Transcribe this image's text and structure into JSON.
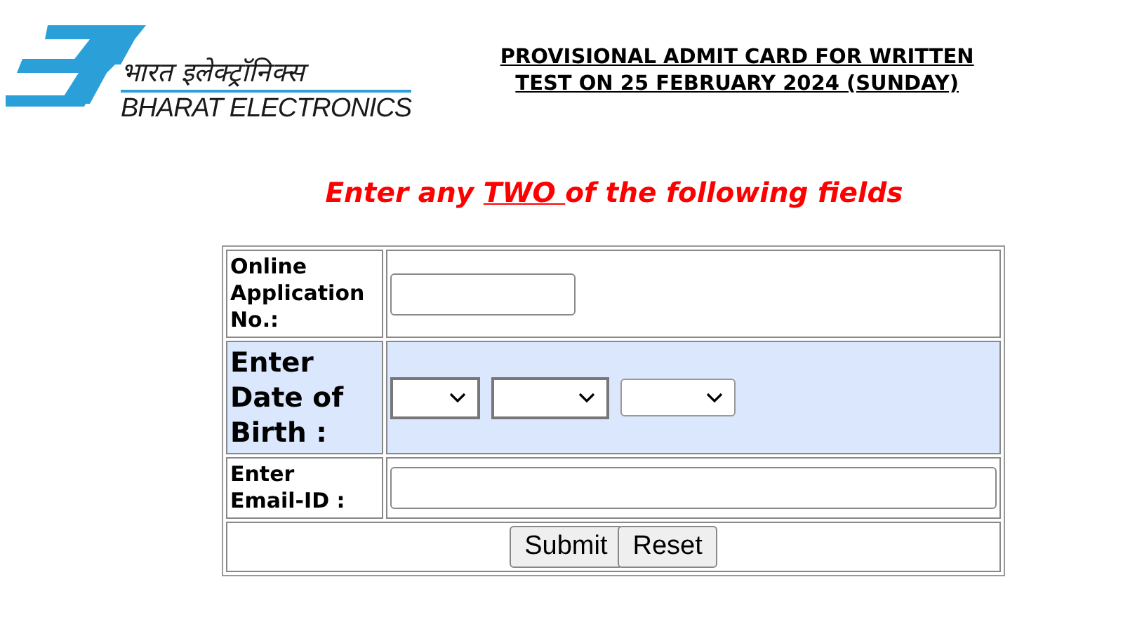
{
  "logo": {
    "hindi_name": "भारत इलेक्ट्रॉनिक्स",
    "english_name": "BHARAT ELECTRONICS"
  },
  "title": {
    "line_1": "PROVISIONAL ADMIT CARD FOR WRITTEN",
    "line_2": "TEST ON 25 FEBRUARY 2024 (SUNDAY)"
  },
  "instruction": {
    "before": "Enter any ",
    "emphasis": "TWO ",
    "after": "of the following fields"
  },
  "form_rows": [
    {
      "kind": "text",
      "label_lines": [
        "Online",
        "Application",
        "No.:"
      ],
      "large_label": false,
      "highlighted": false
    },
    {
      "kind": "date",
      "label_lines": [
        "Enter",
        "Date of",
        "Birth :"
      ],
      "large_label": true,
      "highlighted": true
    },
    {
      "kind": "email",
      "label_lines": [
        "Enter",
        "Email-ID :"
      ],
      "large_label": false,
      "highlighted": false
    }
  ],
  "buttons": [
    {
      "label": "Submit"
    },
    {
      "label": "Reset"
    }
  ]
}
